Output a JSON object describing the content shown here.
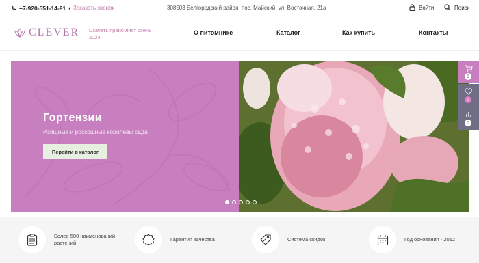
{
  "topbar": {
    "phone": "+7-920-551-14-91",
    "callback": "Заказать звонок",
    "address": "308503 Белгородский район, пос. Майский, ул. Восточная, 21а",
    "login": "Войти",
    "search": "Поиск"
  },
  "header": {
    "logo_text": "CLEVER",
    "price_link": "Скачать прайс-лист осень 2024",
    "nav": [
      "О питомнике",
      "Каталог",
      "Как купить",
      "Контакты"
    ]
  },
  "hero": {
    "title": "Гортензии",
    "subtitle": "Изящные и роскошные королевы сада",
    "cta": "Перейти в каталог",
    "slides": 5,
    "active_slide": 1
  },
  "sidetools": {
    "cart_count": "0",
    "favorites_count": "0",
    "compare_count": "0"
  },
  "features": [
    "Более 500 наименований растений",
    "Гарантия качества",
    "Система скидок",
    "Год основания - 2012"
  ],
  "colors": {
    "accent": "#c77fbf",
    "accent_text": "#c07aa8",
    "tools_bg": "#6f6e85"
  }
}
